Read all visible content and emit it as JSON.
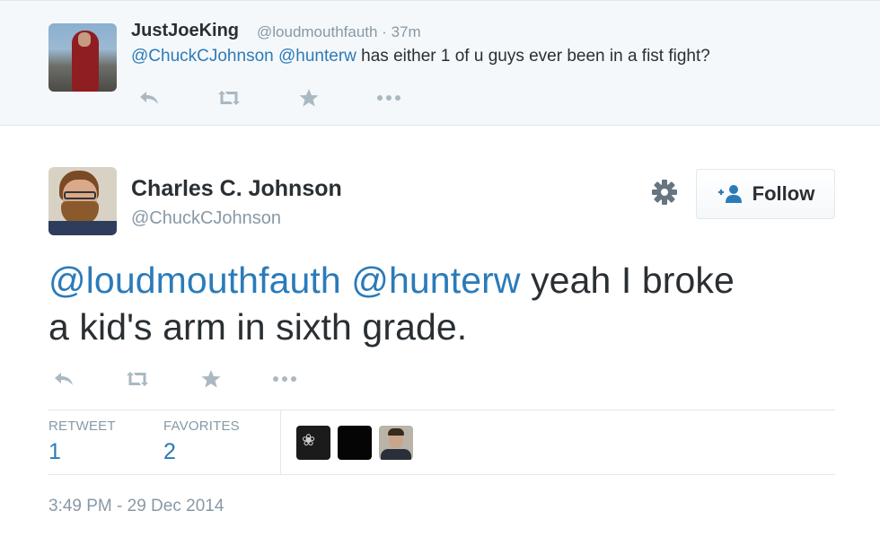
{
  "parent_tweet": {
    "name": "JustJoeKing",
    "meta": "@loudmouthfauth · 37m",
    "mentions": [
      "@ChuckCJohnson",
      "@hunterw"
    ],
    "text": "has either 1 of u guys ever been in a fist fight?"
  },
  "main_tweet": {
    "name": "Charles C. Johnson",
    "handle": "@ChuckCJohnson",
    "follow_label": "Follow",
    "mentions": [
      "@loudmouthfauth",
      "@hunterw"
    ],
    "text_line1": "yeah I broke",
    "text_line2": "a kid's arm in sixth grade.",
    "stats": {
      "retweet_label": "RETWEET",
      "retweet_count": "1",
      "favorites_label": "FAVORITES",
      "favorites_count": "2"
    },
    "timestamp": "3:49 PM - 29 Dec 2014"
  },
  "icons": [
    "reply-icon",
    "retweet-icon",
    "favorite-icon",
    "more-icon",
    "gear-icon",
    "follow-person-icon"
  ],
  "colors": {
    "link": "#2b7bb9",
    "muted": "#8899a6",
    "text": "#292f33",
    "icon": "#aab8c2",
    "parent_bg": "#f5f8fa",
    "border": "#e1e8ed"
  }
}
